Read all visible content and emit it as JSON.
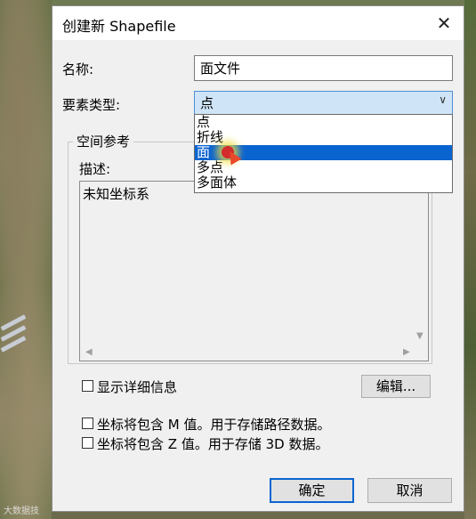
{
  "dialog": {
    "title": "创建新 Shapefile",
    "close_glyph": "✕"
  },
  "form": {
    "name_label": "名称:",
    "name_value": "面文件",
    "feature_type_label": "要素类型:",
    "feature_type_value": "点",
    "feature_type_options": [
      "点",
      "折线",
      "面",
      "多点",
      "多面体"
    ],
    "selected_option_index": 2
  },
  "spatial_ref": {
    "group_title": "空间参考",
    "desc_label": "描述:",
    "desc_value": "未知坐标系",
    "show_details_label": "显示详细信息",
    "edit_button": "编辑..."
  },
  "options": {
    "m_values_label": "坐标将包含 M 值。用于存储路径数据。",
    "z_values_label": "坐标将包含 Z 值。用于存储 3D 数据。"
  },
  "actions": {
    "ok_label": "确定",
    "cancel_label": "取消"
  },
  "watermark": "大数据技",
  "colors": {
    "accent": "#0a64d0",
    "combo_bg": "#cfe4f7"
  }
}
